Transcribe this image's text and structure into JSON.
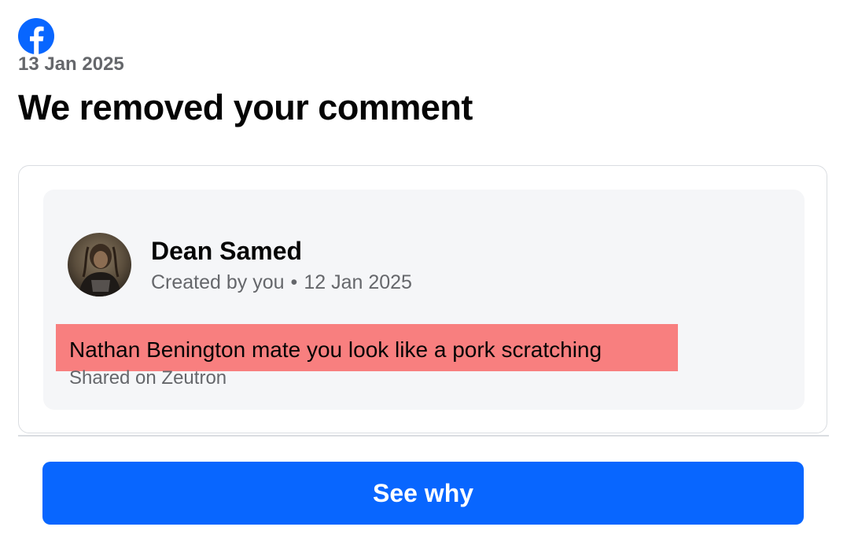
{
  "header": {
    "logo_icon": "facebook-logo-icon",
    "date": "13 Jan 2025",
    "title": "We removed your comment"
  },
  "post": {
    "author_name": "Dean Samed",
    "avatar_icon": "user-avatar",
    "created_label": "Created by you",
    "separator": "•",
    "created_date": "12 Jan 2025",
    "comment": "Nathan Benington mate you look like a pork scratching",
    "shared_on": "Shared on Zeutron"
  },
  "actions": {
    "see_why_label": "See why"
  },
  "colors": {
    "brand_blue": "#0866ff",
    "highlight_red": "#f87f7f",
    "secondary_text": "#65676b"
  }
}
